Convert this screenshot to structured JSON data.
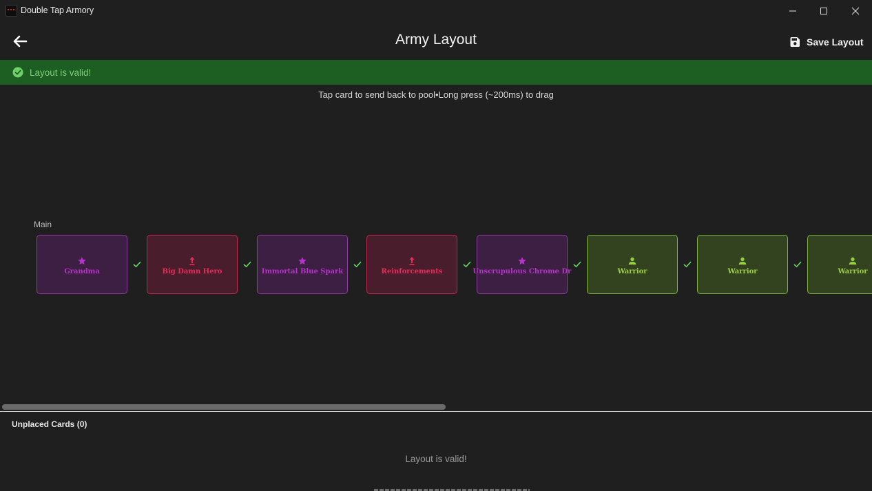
{
  "window": {
    "title": "Double Tap Armory"
  },
  "appbar": {
    "title": "Army Layout",
    "save_label": "Save Layout"
  },
  "banner": {
    "text": "Layout is valid!",
    "color": "#1d5e22"
  },
  "hint": "Tap card to send back to pool•Long press (~200ms) to drag",
  "layout": {
    "row_label": "Main",
    "cards": [
      {
        "name": "Grandma",
        "icon": "star-icon",
        "color": "purple"
      },
      {
        "name": "Big Damn Hero",
        "icon": "upgrade-arrow-icon",
        "color": "red"
      },
      {
        "name": "Immortal Blue Spark",
        "icon": "star-icon",
        "color": "purple"
      },
      {
        "name": "Reinforcements",
        "icon": "upgrade-arrow-icon",
        "color": "red"
      },
      {
        "name": "Unscrupulous Chrome Dr",
        "icon": "star-icon",
        "color": "purple"
      },
      {
        "name": "Warrior",
        "icon": "person-icon",
        "color": "green"
      },
      {
        "name": "Warrior",
        "icon": "person-icon",
        "color": "green"
      },
      {
        "name": "Warrior",
        "icon": "person-icon",
        "color": "green"
      }
    ]
  },
  "pool": {
    "title": "Unplaced Cards (0)",
    "message": "Layout is valid!"
  },
  "colors": {
    "purple": "#b533c8",
    "red": "#e52c5d",
    "green": "#9ad03f",
    "check": "#5fcf5f"
  }
}
